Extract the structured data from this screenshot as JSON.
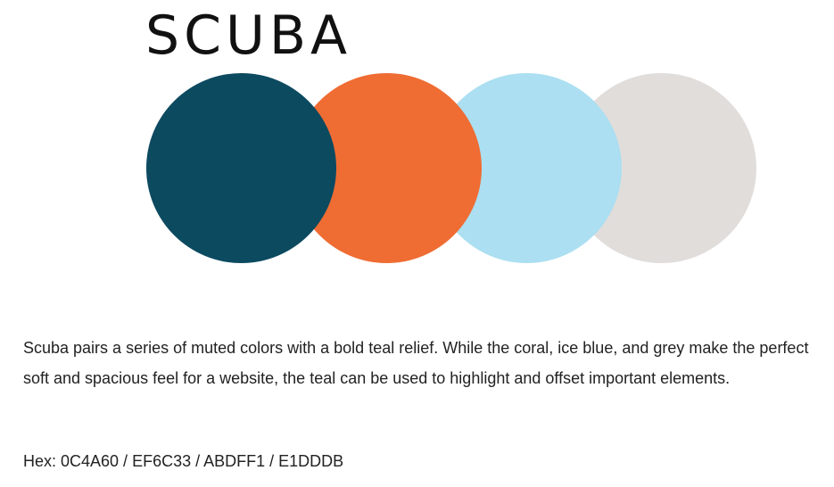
{
  "palette": {
    "title": "SCUBA",
    "swatches": [
      {
        "name": "teal",
        "color": "#0C4A60"
      },
      {
        "name": "coral",
        "color": "#EF6C33"
      },
      {
        "name": "ice-blue",
        "color": "#ABDFF1"
      },
      {
        "name": "grey",
        "color": "#E1DDDB"
      }
    ]
  },
  "article": {
    "description": "Scuba pairs a series of muted colors with a bold teal relief. While the coral, ice blue, and grey make the perfect soft and spacious feel for a website, the teal can be used to highlight and offset important elements.",
    "hex_line": "Hex: 0C4A60 / EF6C33 / ABDFF1 / E1DDDB"
  }
}
